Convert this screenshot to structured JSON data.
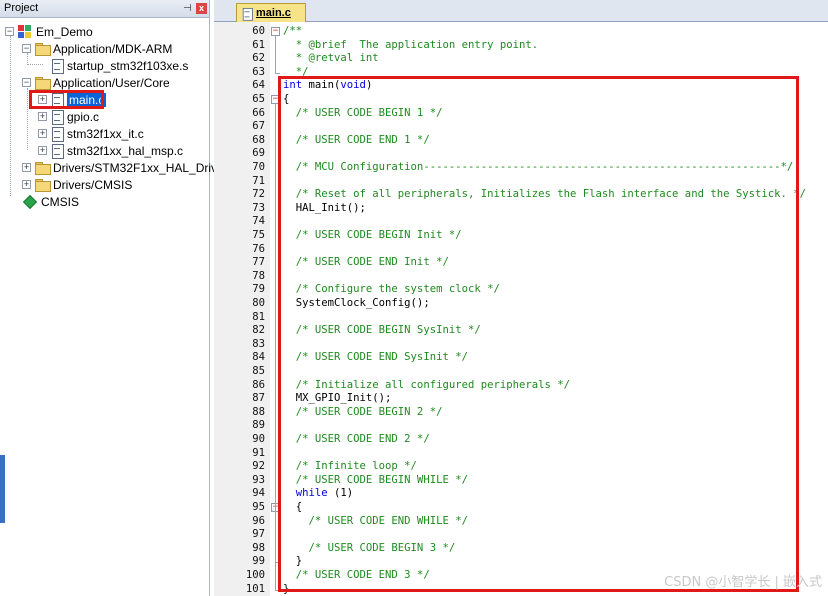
{
  "project_panel": {
    "title": "Project",
    "pin_glyph": "📌",
    "close_glyph": "x",
    "tree": [
      {
        "label": "Em_Demo",
        "icon": "project-icon",
        "expander": "−"
      },
      {
        "label": "Application/MDK-ARM",
        "icon": "folder-icon",
        "expander": "−"
      },
      {
        "label": "startup_stm32f103xe.s",
        "icon": "file-icon",
        "expander": ""
      },
      {
        "label": "Application/User/Core",
        "icon": "folder-icon",
        "expander": "−"
      },
      {
        "label": "main.c",
        "icon": "file-icon",
        "expander": "+",
        "selected": true
      },
      {
        "label": "gpio.c",
        "icon": "file-icon",
        "expander": "+"
      },
      {
        "label": "stm32f1xx_it.c",
        "icon": "file-icon",
        "expander": "+"
      },
      {
        "label": "stm32f1xx_hal_msp.c",
        "icon": "file-icon",
        "expander": "+"
      },
      {
        "label": "Drivers/STM32F1xx_HAL_Driver",
        "icon": "folder-icon",
        "expander": "+"
      },
      {
        "label": "Drivers/CMSIS",
        "icon": "folder-icon",
        "expander": "+"
      },
      {
        "label": "CMSIS",
        "icon": "gem-icon",
        "expander": ""
      }
    ]
  },
  "editor": {
    "active_tab": "main.c",
    "lines": [
      {
        "n": "60",
        "t": "/**",
        "c": "cm"
      },
      {
        "n": "61",
        "t": "  * @brief  The application entry point.",
        "c": "cm"
      },
      {
        "n": "62",
        "t": "  * @retval int",
        "c": "cm"
      },
      {
        "n": "63",
        "t": "  */",
        "c": "cm"
      },
      {
        "n": "64",
        "t": "int main(void)",
        "c": "sig"
      },
      {
        "n": "65",
        "t": "{",
        "c": "tx"
      },
      {
        "n": "66",
        "t": "  /* USER CODE BEGIN 1 */",
        "c": "cm"
      },
      {
        "n": "67",
        "t": "",
        "c": "tx"
      },
      {
        "n": "68",
        "t": "  /* USER CODE END 1 */",
        "c": "cm"
      },
      {
        "n": "69",
        "t": "",
        "c": "tx"
      },
      {
        "n": "70",
        "t": "  /* MCU Configuration--------------------------------------------------------*/",
        "c": "cm"
      },
      {
        "n": "71",
        "t": "",
        "c": "tx"
      },
      {
        "n": "72",
        "t": "  /* Reset of all peripherals, Initializes the Flash interface and the Systick. */",
        "c": "cm"
      },
      {
        "n": "73",
        "t": "  HAL_Init();",
        "c": "tx"
      },
      {
        "n": "74",
        "t": "",
        "c": "tx"
      },
      {
        "n": "75",
        "t": "  /* USER CODE BEGIN Init */",
        "c": "cm"
      },
      {
        "n": "76",
        "t": "",
        "c": "tx"
      },
      {
        "n": "77",
        "t": "  /* USER CODE END Init */",
        "c": "cm"
      },
      {
        "n": "78",
        "t": "",
        "c": "tx"
      },
      {
        "n": "79",
        "t": "  /* Configure the system clock */",
        "c": "cm"
      },
      {
        "n": "80",
        "t": "  SystemClock_Config();",
        "c": "tx"
      },
      {
        "n": "81",
        "t": "",
        "c": "tx"
      },
      {
        "n": "82",
        "t": "  /* USER CODE BEGIN SysInit */",
        "c": "cm"
      },
      {
        "n": "83",
        "t": "",
        "c": "tx"
      },
      {
        "n": "84",
        "t": "  /* USER CODE END SysInit */",
        "c": "cm"
      },
      {
        "n": "85",
        "t": "",
        "c": "tx"
      },
      {
        "n": "86",
        "t": "  /* Initialize all configured peripherals */",
        "c": "cm"
      },
      {
        "n": "87",
        "t": "  MX_GPIO_Init();",
        "c": "tx"
      },
      {
        "n": "88",
        "t": "  /* USER CODE BEGIN 2 */",
        "c": "cm"
      },
      {
        "n": "89",
        "t": "",
        "c": "tx"
      },
      {
        "n": "90",
        "t": "  /* USER CODE END 2 */",
        "c": "cm"
      },
      {
        "n": "91",
        "t": "",
        "c": "tx"
      },
      {
        "n": "92",
        "t": "  /* Infinite loop */",
        "c": "cm"
      },
      {
        "n": "93",
        "t": "  /* USER CODE BEGIN WHILE */",
        "c": "cm"
      },
      {
        "n": "94",
        "t": "  while (1)",
        "c": "while"
      },
      {
        "n": "95",
        "t": "  {",
        "c": "tx"
      },
      {
        "n": "96",
        "t": "    /* USER CODE END WHILE */",
        "c": "cm"
      },
      {
        "n": "97",
        "t": "",
        "c": "tx"
      },
      {
        "n": "98",
        "t": "    /* USER CODE BEGIN 3 */",
        "c": "cm"
      },
      {
        "n": "99",
        "t": "  }",
        "c": "tx"
      },
      {
        "n": "100",
        "t": "  /* USER CODE END 3 */",
        "c": "cm"
      },
      {
        "n": "101",
        "t": "}",
        "c": "tx"
      }
    ]
  },
  "watermark": "CSDN @小智学长 | 嵌入式",
  "colors": {
    "comment": "#1f8a1f",
    "keyword": "#0000e0",
    "highlight": "#e01818",
    "selection": "#0a64d8",
    "tab_active": "#f7e489"
  }
}
